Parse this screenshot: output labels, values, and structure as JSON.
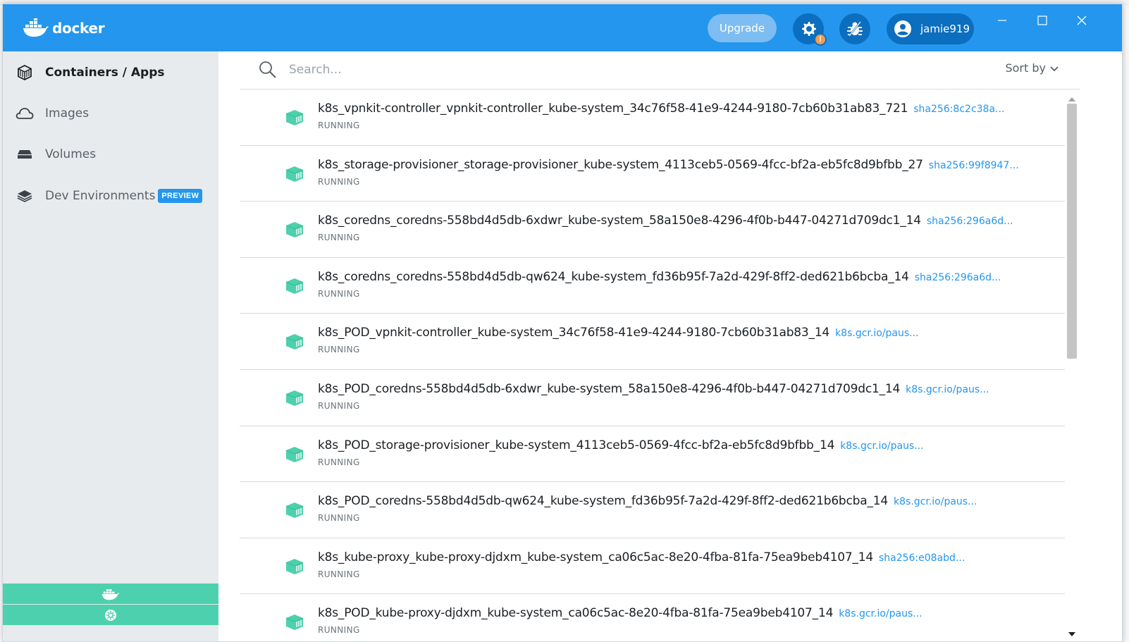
{
  "app": {
    "brand": "docker"
  },
  "header": {
    "upgrade_label": "Upgrade",
    "settings_badge": "!",
    "user_name": "jamie919"
  },
  "sidebar": {
    "items": [
      {
        "label": "Containers / Apps",
        "icon": "containers-icon",
        "active": true
      },
      {
        "label": "Images",
        "icon": "cloud-icon"
      },
      {
        "label": "Volumes",
        "icon": "volume-disk-icon"
      },
      {
        "label": "Dev Environments",
        "icon": "layers-icon",
        "badge": "PREVIEW"
      }
    ]
  },
  "search": {
    "placeholder": "Search..."
  },
  "sort": {
    "label": "Sort by"
  },
  "containers": [
    {
      "name": "k8s_vpnkit-controller_vpnkit-controller_kube-system_34c76f58-41e9-4244-9180-7cb60b31ab83_721",
      "image": "sha256:8c2c38a...",
      "status": "RUNNING"
    },
    {
      "name": "k8s_storage-provisioner_storage-provisioner_kube-system_4113ceb5-0569-4fcc-bf2a-eb5fc8d9bfbb_27",
      "image": "sha256:99f8947...",
      "status": "RUNNING"
    },
    {
      "name": "k8s_coredns_coredns-558bd4d5db-6xdwr_kube-system_58a150e8-4296-4f0b-b447-04271d709dc1_14",
      "image": "sha256:296a6d...",
      "status": "RUNNING"
    },
    {
      "name": "k8s_coredns_coredns-558bd4d5db-qw624_kube-system_fd36b95f-7a2d-429f-8ff2-ded621b6bcba_14",
      "image": "sha256:296a6d...",
      "status": "RUNNING"
    },
    {
      "name": "k8s_POD_vpnkit-controller_kube-system_34c76f58-41e9-4244-9180-7cb60b31ab83_14",
      "image": "k8s.gcr.io/paus...",
      "status": "RUNNING"
    },
    {
      "name": "k8s_POD_coredns-558bd4d5db-6xdwr_kube-system_58a150e8-4296-4f0b-b447-04271d709dc1_14",
      "image": "k8s.gcr.io/paus...",
      "status": "RUNNING"
    },
    {
      "name": "k8s_POD_storage-provisioner_kube-system_4113ceb5-0569-4fcc-bf2a-eb5fc8d9bfbb_14",
      "image": "k8s.gcr.io/paus...",
      "status": "RUNNING"
    },
    {
      "name": "k8s_POD_coredns-558bd4d5db-qw624_kube-system_fd36b95f-7a2d-429f-8ff2-ded621b6bcba_14",
      "image": "k8s.gcr.io/paus...",
      "status": "RUNNING"
    },
    {
      "name": "k8s_kube-proxy_kube-proxy-djdxm_kube-system_ca06c5ac-8e20-4fba-81fa-75ea9beb4107_14",
      "image": "sha256:e08abd...",
      "status": "RUNNING"
    },
    {
      "name": "k8s_POD_kube-proxy-djdxm_kube-system_ca06c5ac-8e20-4fba-81fa-75ea9beb4107_14",
      "image": "k8s.gcr.io/paus...",
      "status": "RUNNING"
    }
  ],
  "colors": {
    "header": "#2496ed",
    "sidebar": "#e8ebed",
    "engine_running": "#4dd0ae",
    "link": "#2496ed",
    "container_icon": "#4dd0ae"
  }
}
